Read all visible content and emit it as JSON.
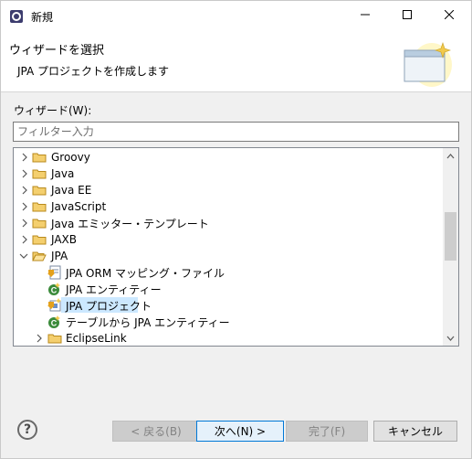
{
  "window": {
    "title": "新規",
    "icon": "eclipse-new-icon",
    "controls": [
      "minimize-icon",
      "maximize-icon",
      "close-icon"
    ]
  },
  "banner": {
    "title": "ウィザードを選択",
    "description": "JPA プロジェクトを作成します",
    "graphic": "new-wizard-banner-icon"
  },
  "wizard": {
    "label": "ウィザード(W):",
    "filter_placeholder": "フィルター入力",
    "filter_value": ""
  },
  "tree": {
    "items": [
      {
        "label": "Groovy",
        "expanded": false,
        "icon": "folder-icon"
      },
      {
        "label": "Java",
        "expanded": false,
        "icon": "folder-icon"
      },
      {
        "label": "Java EE",
        "expanded": false,
        "icon": "folder-icon"
      },
      {
        "label": "JavaScript",
        "expanded": false,
        "icon": "folder-icon"
      },
      {
        "label": "Java エミッター・テンプレート",
        "expanded": false,
        "icon": "folder-icon"
      },
      {
        "label": "JAXB",
        "expanded": false,
        "icon": "folder-icon"
      },
      {
        "label": "JPA",
        "expanded": true,
        "icon": "folder-open-icon"
      },
      {
        "label": "JPA ORM マッピング・ファイル",
        "icon": "orm-file-icon"
      },
      {
        "label": "JPA エンティティー",
        "icon": "entity-icon"
      },
      {
        "label": "JPA プロジェクト",
        "icon": "jpa-project-icon",
        "selected": true
      },
      {
        "label": "テーブルから JPA エンティティー",
        "icon": "entity-icon"
      },
      {
        "label": "EclipseLink",
        "expanded": false,
        "icon": "folder-icon"
      }
    ]
  },
  "buttons": {
    "help": "?",
    "back": "< 戻る(B)",
    "next": "次へ(N) >",
    "finish": "完了(F)",
    "cancel": "キャンセル"
  },
  "colors": {
    "selection": "#cce8ff",
    "primary_border": "#0078d7",
    "folder": "#e8b94a"
  }
}
